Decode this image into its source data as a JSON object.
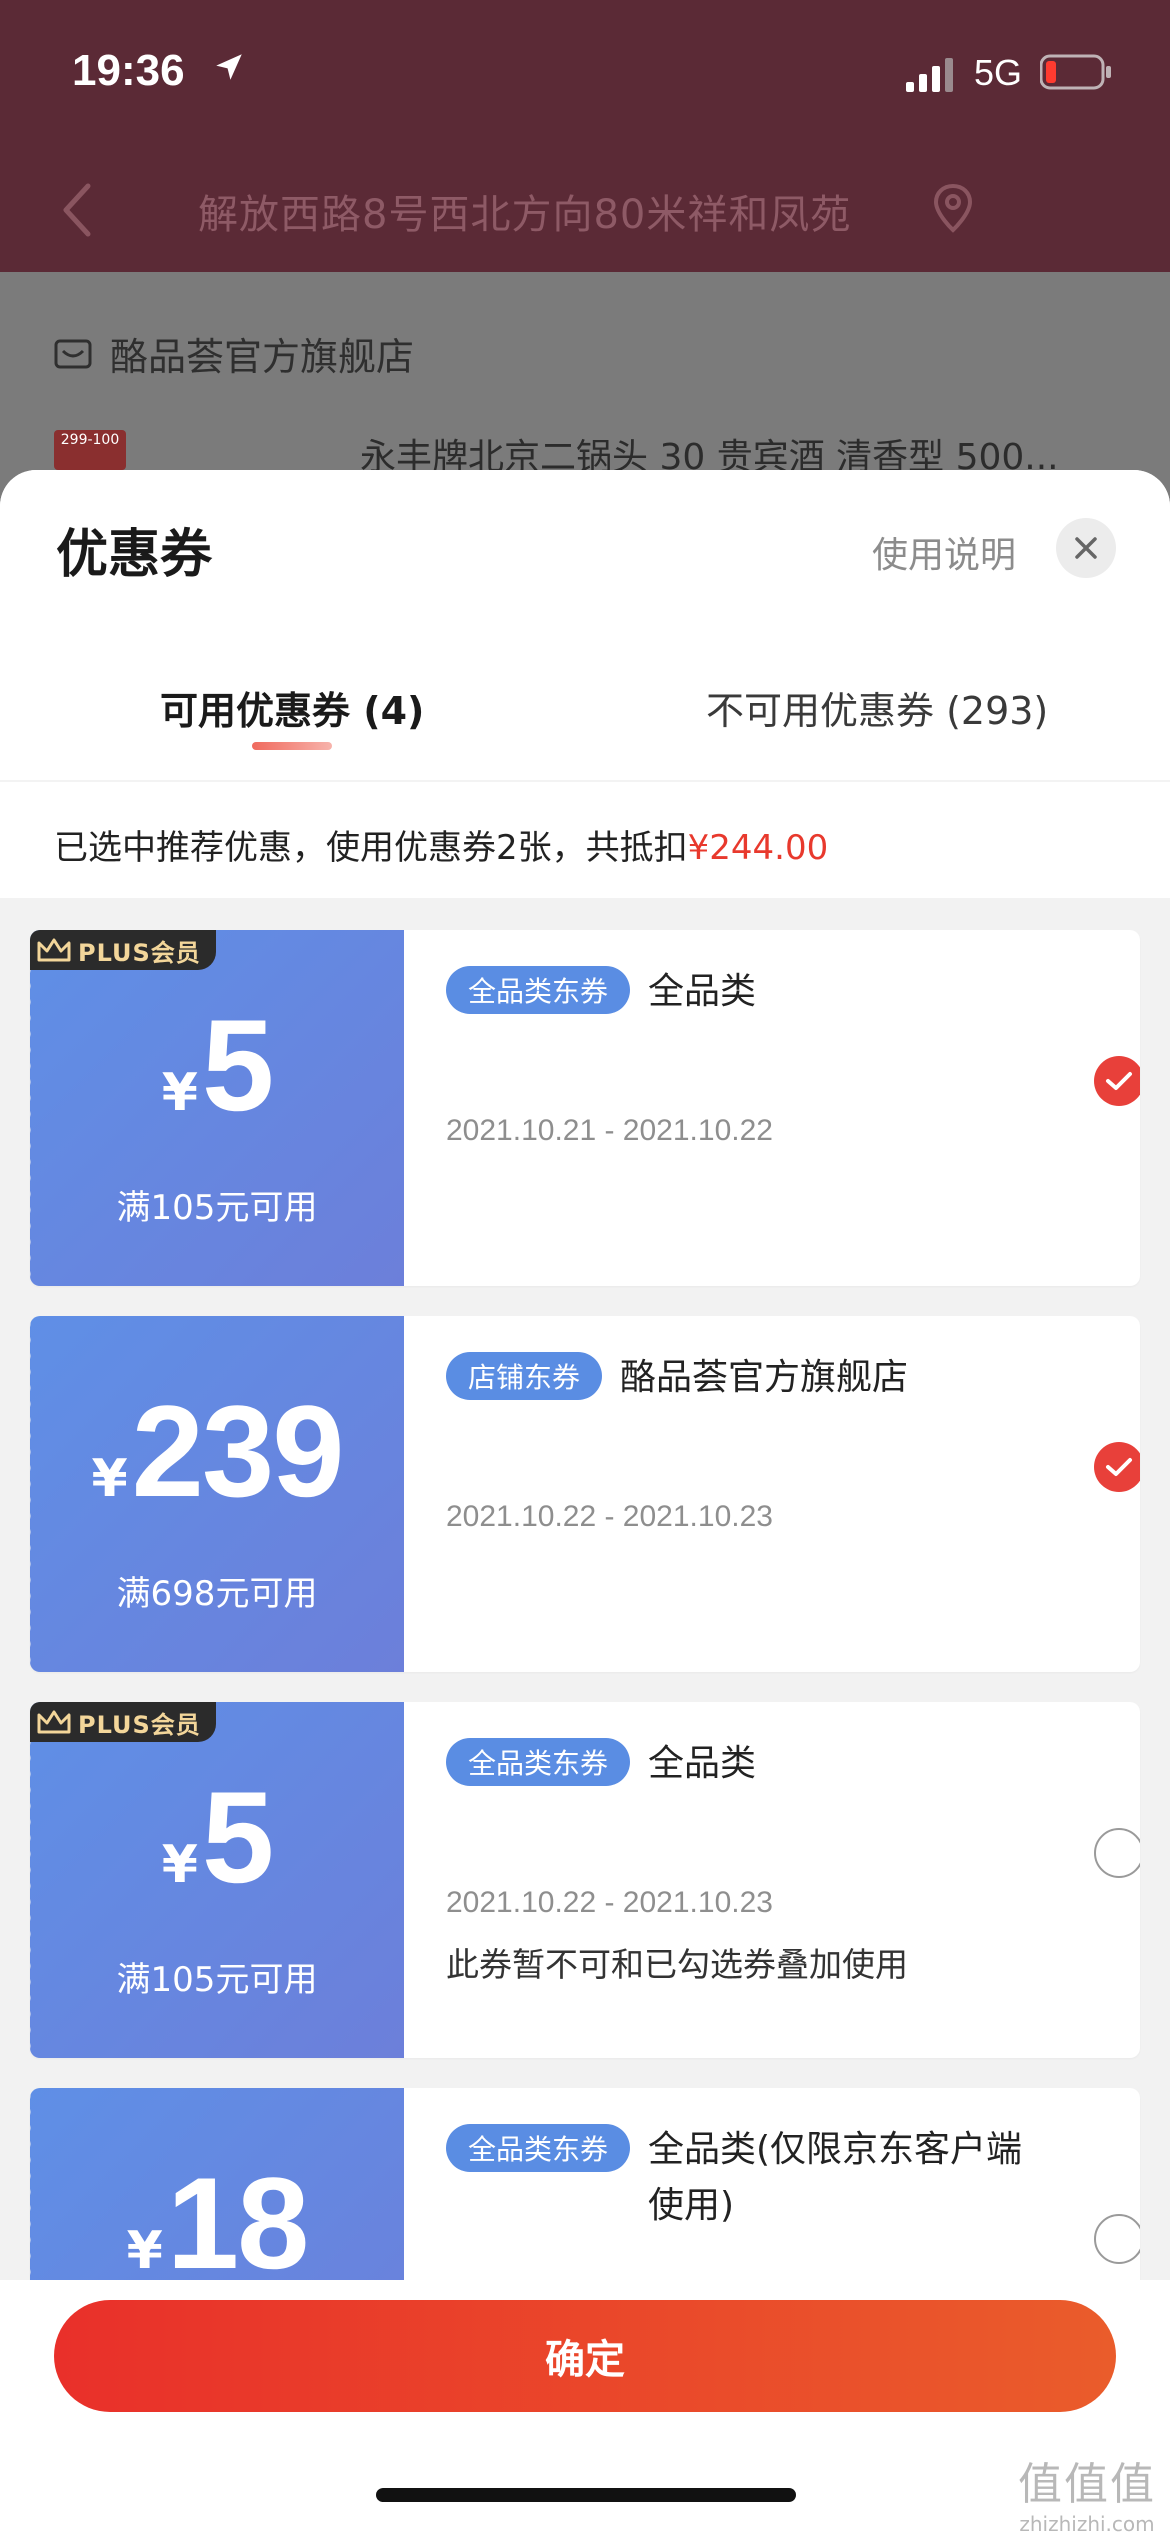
{
  "status_bar": {
    "time": "19:36",
    "network": "5G"
  },
  "address_bar": {
    "address": "解放西路8号西北方向80米祥和凤苑"
  },
  "background": {
    "shop_name": "酪品荟官方旗舰店",
    "product_badge": "299-100",
    "product_title": "永丰牌北京二锅头 30 贵宾酒 清香型 500..."
  },
  "sheet": {
    "title": "优惠券",
    "usage_link": "使用说明",
    "tabs": [
      {
        "label": "可用优惠券 (4)",
        "active": true
      },
      {
        "label": "不可用优惠券 (293)",
        "active": false
      }
    ],
    "summary_prefix": "已选中推荐优惠，使用优惠券2张，共抵扣",
    "summary_amount": "¥244.00"
  },
  "coupons": [
    {
      "plus_badge": "PLUS会员",
      "currency": "¥",
      "amount": "5",
      "threshold": "满105元可用",
      "tag": "全品类东券",
      "scope": "全品类",
      "date_range": "2021.10.21 - 2021.10.22",
      "note": "",
      "selected": true
    },
    {
      "plus_badge": "",
      "currency": "¥",
      "amount": "239",
      "threshold": "满698元可用",
      "tag": "店铺东券",
      "scope": "酪品荟官方旗舰店",
      "date_range": "2021.10.22 - 2021.10.23",
      "note": "",
      "selected": true
    },
    {
      "plus_badge": "PLUS会员",
      "currency": "¥",
      "amount": "5",
      "threshold": "满105元可用",
      "tag": "全品类东券",
      "scope": "全品类",
      "date_range": "2021.10.22 - 2021.10.23",
      "note": "此券暂不可和已勾选券叠加使用",
      "selected": false
    },
    {
      "plus_badge": "",
      "currency": "¥",
      "amount": "18",
      "threshold": "",
      "tag": "全品类东券",
      "scope": "全品类(仅限京东客户端使用)",
      "date_range": "",
      "note": "",
      "selected": false
    }
  ],
  "confirm_label": "确定",
  "watermark": {
    "glyphs": "值值值",
    "domain": "zhizhizhi.com"
  },
  "colors": {
    "accent_red": "#e8392d",
    "coupon_blue": "#5f8fe6",
    "tag_blue": "#5a8de3"
  },
  "icons": [
    "location-arrow-icon",
    "signal-icon",
    "battery-icon",
    "back-icon",
    "map-pin-icon",
    "shop-icon",
    "close-icon",
    "crown-icon",
    "check-icon"
  ]
}
